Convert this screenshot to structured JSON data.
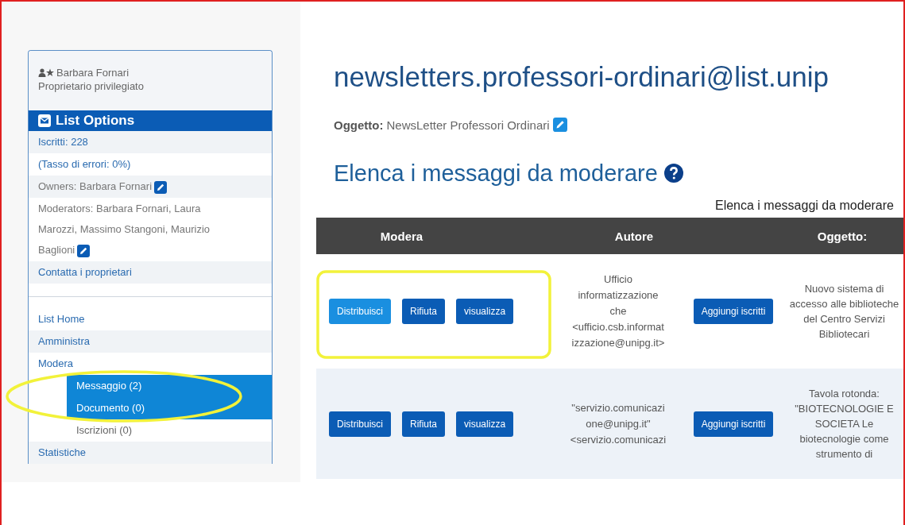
{
  "sidebar": {
    "user_name": "Barbara Fornari",
    "user_role": "Proprietario privilegiato",
    "header": "List Options",
    "info_items": [
      {
        "kind": "link",
        "text": "Iscritti: 228",
        "editable": false
      },
      {
        "kind": "link",
        "text": "(Tasso di errori: 0%)",
        "editable": false
      },
      {
        "kind": "text",
        "text": "Owners: Barbara Fornari",
        "editable": true
      },
      {
        "kind": "text",
        "text": "Moderators: Barbara Fornari, Laura Marozzi, Massimo Stangoni, Maurizio Baglioni",
        "editable": true
      },
      {
        "kind": "link",
        "text": "Contatta i proprietari",
        "editable": false
      }
    ],
    "nav_items": [
      {
        "label": "List Home",
        "selected": false
      },
      {
        "label": "Amministra",
        "selected": false
      },
      {
        "label": "Modera",
        "selected": false,
        "children": [
          {
            "label": "Messaggio (2)",
            "selected": true
          },
          {
            "label": "Documento (0)",
            "selected": true
          },
          {
            "label": "Iscrizioni (0)",
            "selected": false
          }
        ]
      },
      {
        "label": "Statistiche",
        "selected": false
      }
    ]
  },
  "main": {
    "title": "newsletters.professori-ordinari@list.unip",
    "subject_label": "Oggetto:",
    "subject": "NewsLetter Professori Ordinari",
    "section_title": "Elenca i messaggi da moderare",
    "table": {
      "caption": "Elenca i messaggi da moderare",
      "columns": [
        "Modera",
        "Autore",
        "Oggetto:"
      ],
      "rows": [
        {
          "buttons": [
            {
              "label": "Distribuisci",
              "hovered": true
            },
            {
              "label": "Rifiuta",
              "hovered": false
            },
            {
              "label": "visualizza",
              "hovered": false
            }
          ],
          "author_lines": [
            "Ufficio",
            "informatizzazione",
            "che",
            "<ufficio.csb.informat",
            "izzazione@unipg.it>"
          ],
          "add_button": "Aggiungi iscritti",
          "subject": "Nuovo sistema di accesso alle biblioteche del Centro Servizi Bibliotecari"
        },
        {
          "buttons": [
            {
              "label": "Distribuisci",
              "hovered": false
            },
            {
              "label": "Rifiuta",
              "hovered": false
            },
            {
              "label": "visualizza",
              "hovered": false
            }
          ],
          "author_lines": [
            "\"servizio.comunicazi",
            "one@unipg.it\"",
            "<servizio.comunicazi"
          ],
          "add_button": "Aggiungi iscritti",
          "subject": "Tavola rotonda: \"BIOTECNOLOGIE E SOCIETA Le biotecnologie come strumento di"
        }
      ]
    }
  },
  "annotations": [
    {
      "kind": "ellipse"
    },
    {
      "kind": "rectangle"
    }
  ]
}
